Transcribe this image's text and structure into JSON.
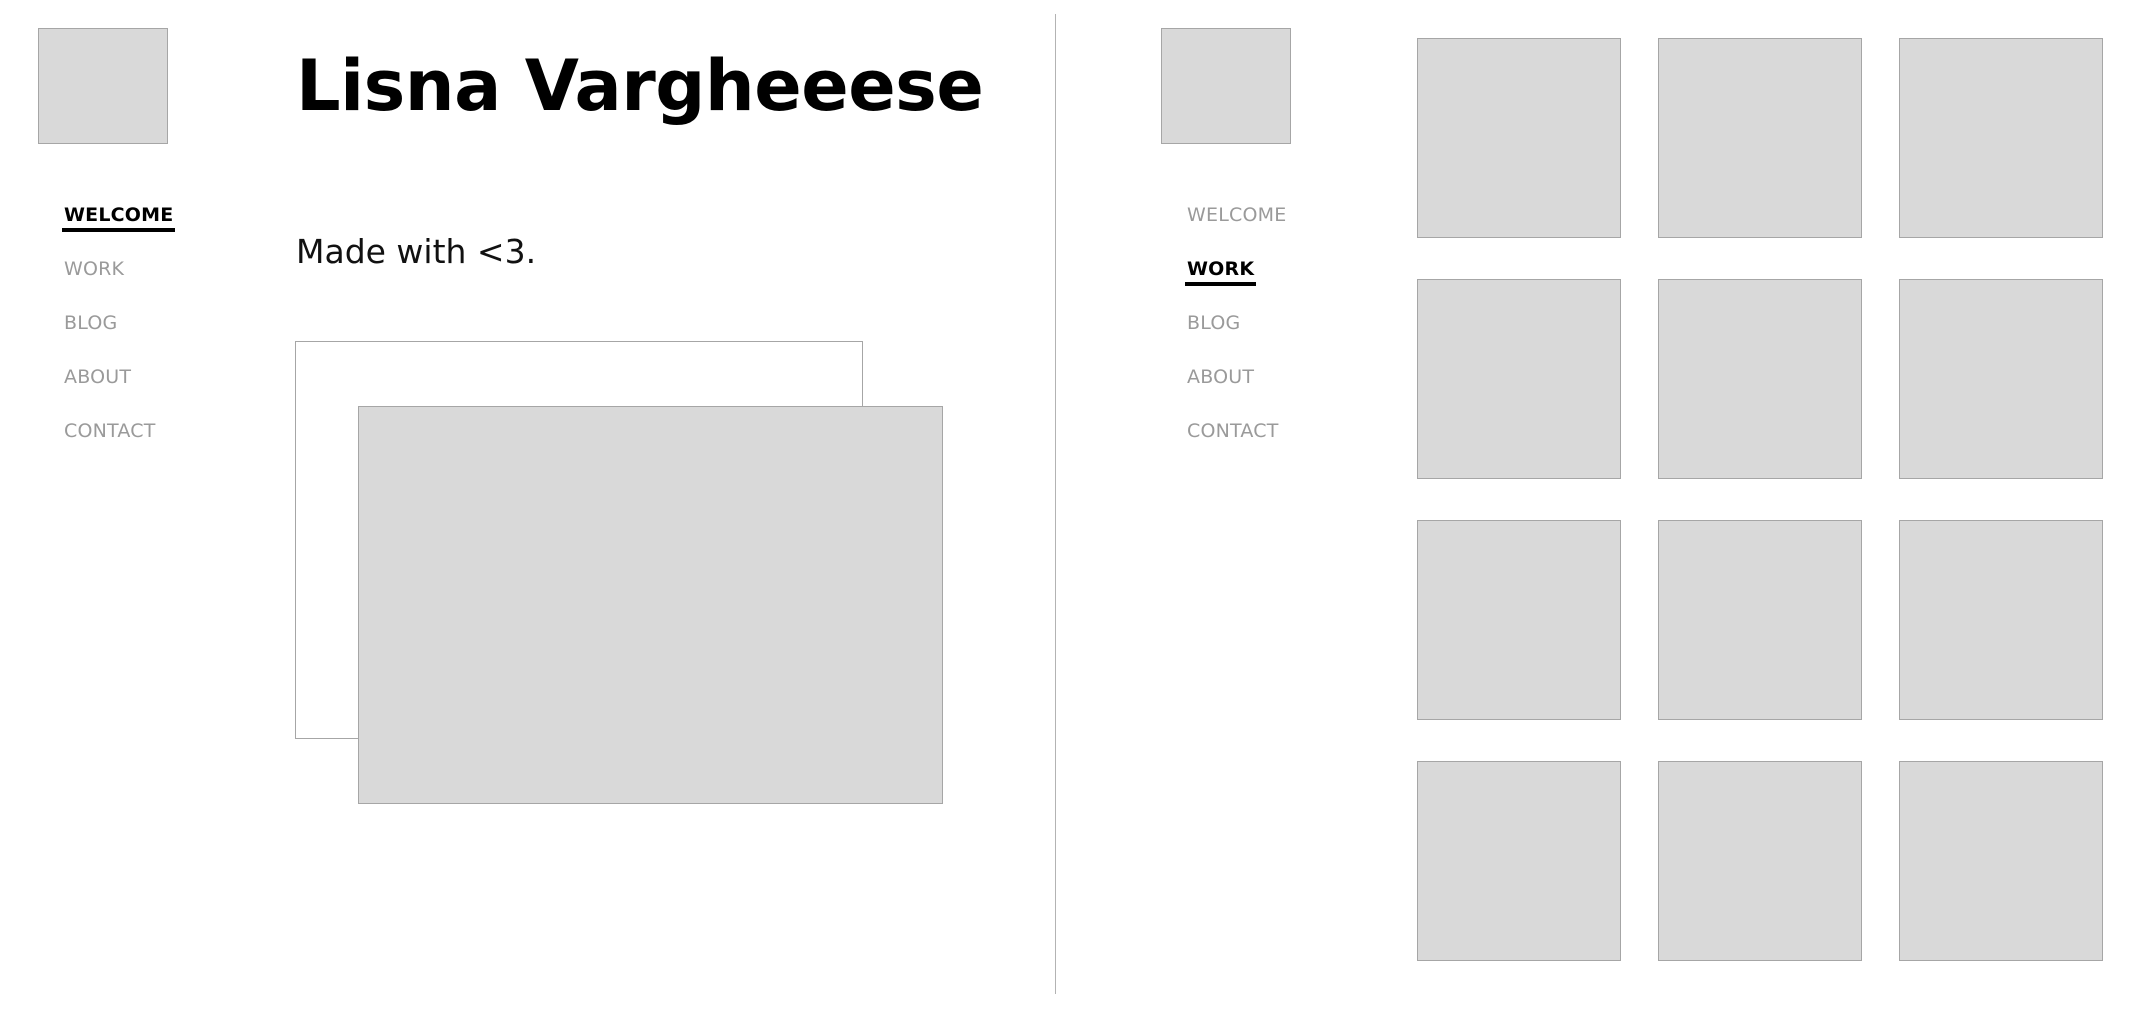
{
  "welcome_page": {
    "nav": {
      "items": [
        {
          "label": "WELCOME",
          "active": true
        },
        {
          "label": "WORK",
          "active": false
        },
        {
          "label": "BLOG",
          "active": false
        },
        {
          "label": "ABOUT",
          "active": false
        },
        {
          "label": "CONTACT",
          "active": false
        }
      ]
    },
    "hero": {
      "title": "Lisna Vargheeese",
      "subtitle": "Made with <3."
    }
  },
  "work_page": {
    "nav": {
      "items": [
        {
          "label": "WELCOME",
          "active": false
        },
        {
          "label": "WORK",
          "active": true
        },
        {
          "label": "BLOG",
          "active": false
        },
        {
          "label": "ABOUT",
          "active": false
        },
        {
          "label": "CONTACT",
          "active": false
        }
      ]
    }
  },
  "colors": {
    "placeholder_fill": "#d9d9d9",
    "placeholder_border": "#a6a6a6",
    "nav_inactive": "#9a9a9a",
    "nav_active": "#000000",
    "divider": "#b3b3b3"
  }
}
